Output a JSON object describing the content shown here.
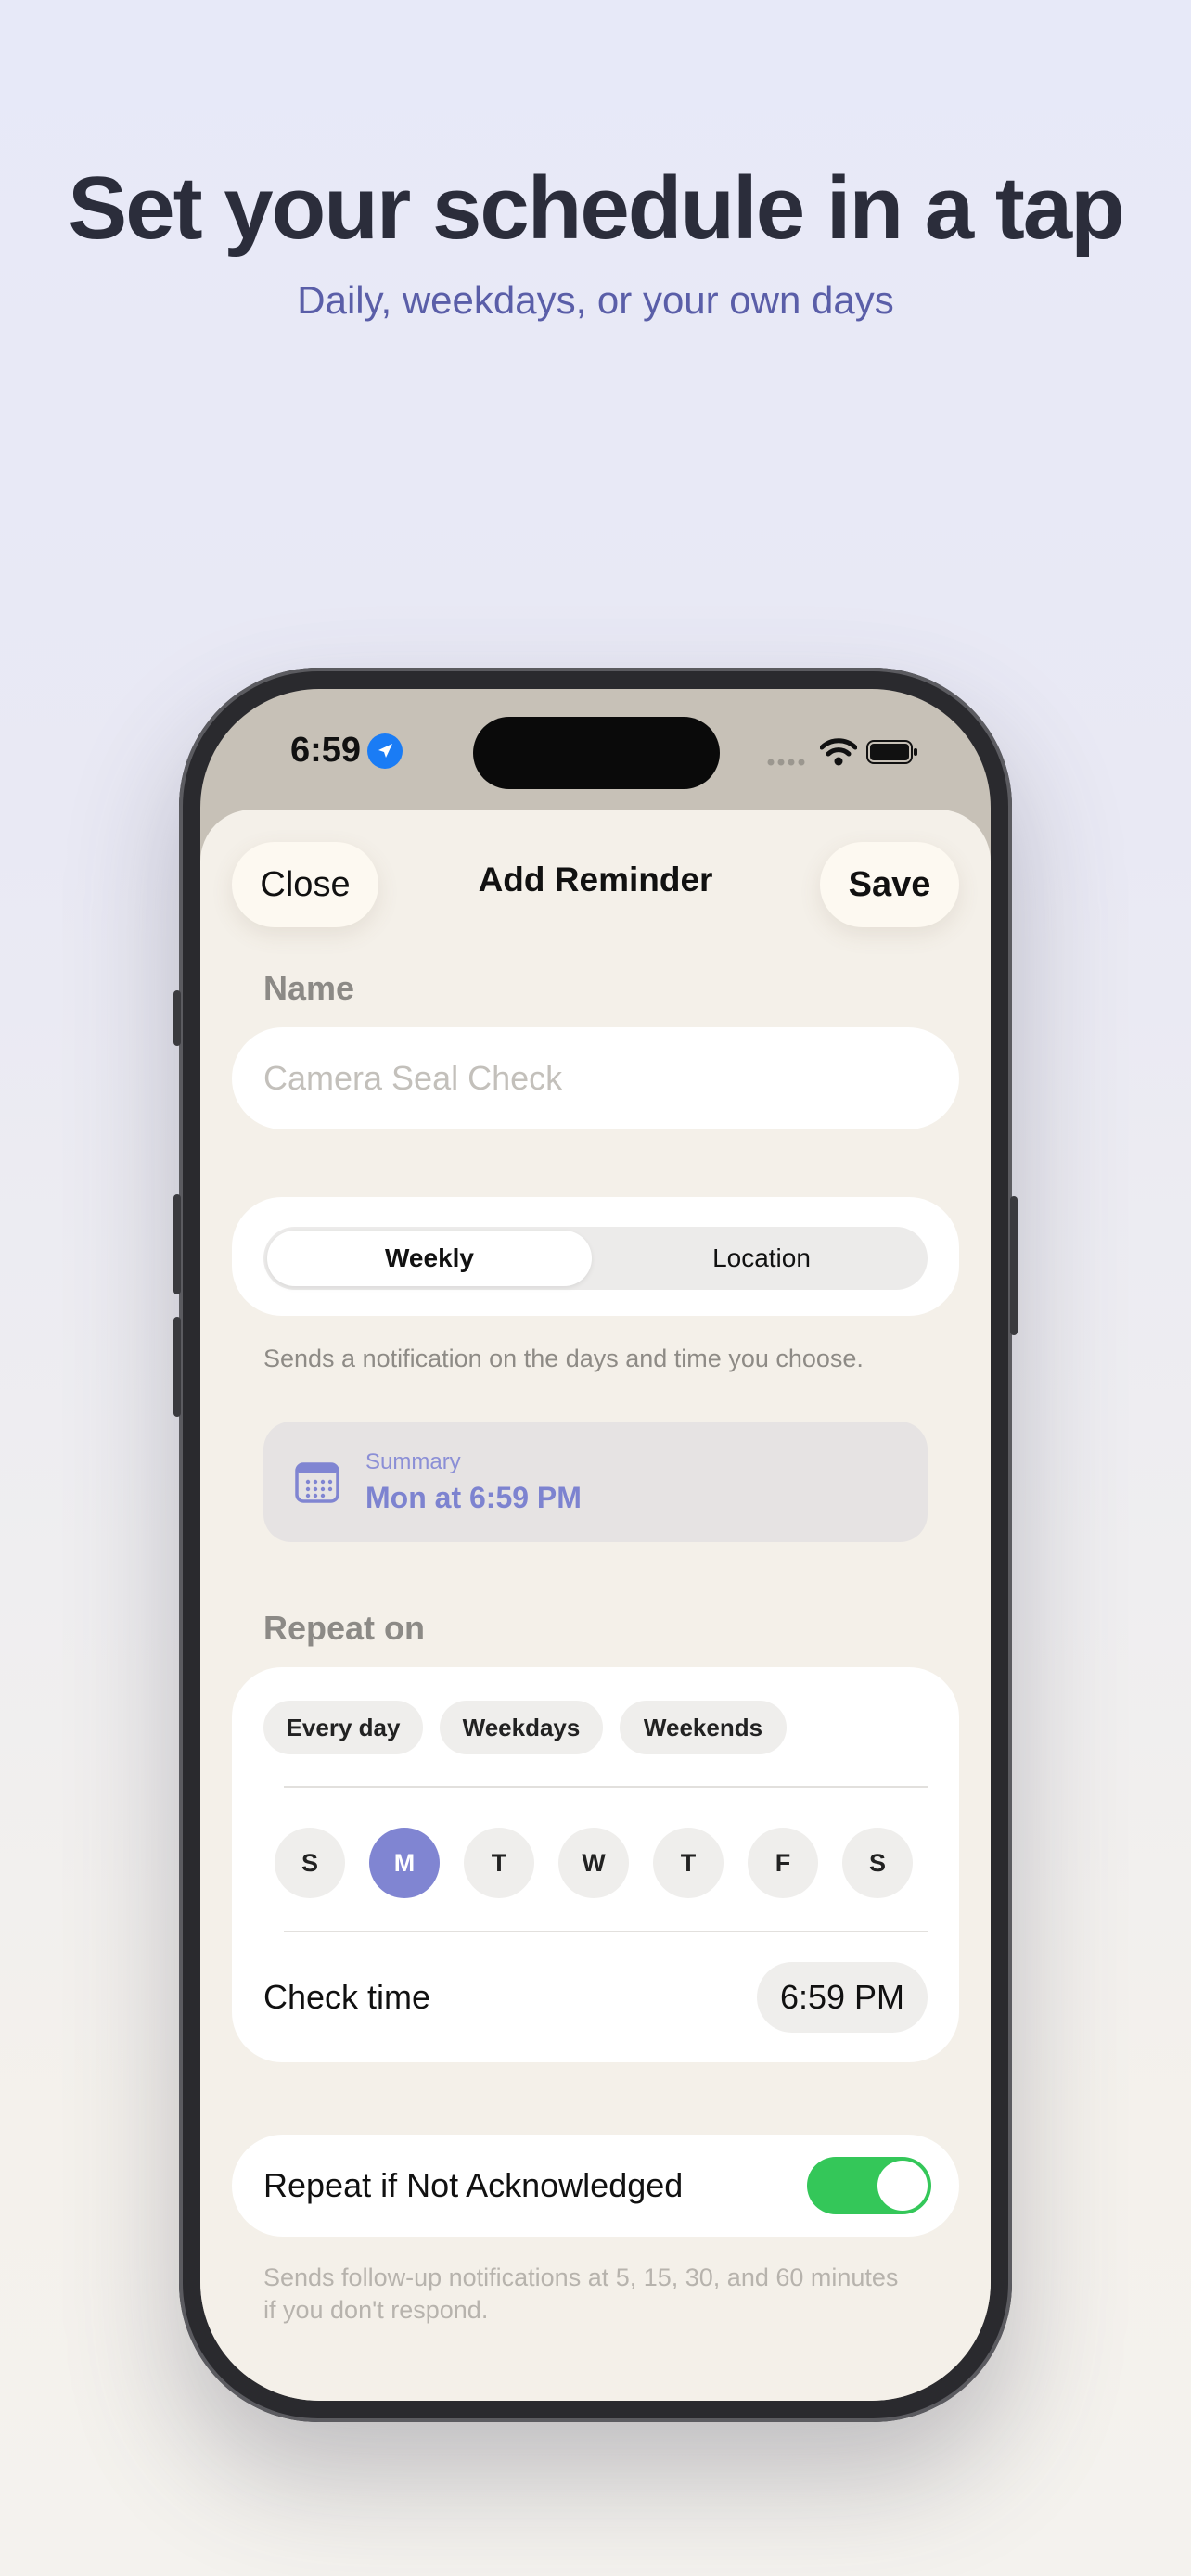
{
  "hero": {
    "title": "Set your schedule in a tap",
    "subtitle": "Daily, weekdays, or your own days"
  },
  "status_bar": {
    "time": "6:59",
    "icons": [
      "location-arrow-icon",
      "signal-icon",
      "wifi-icon",
      "battery-icon"
    ]
  },
  "nav": {
    "close_label": "Close",
    "title": "Add Reminder",
    "save_label": "Save"
  },
  "name_section": {
    "label": "Name",
    "placeholder": "Camera Seal Check",
    "value": ""
  },
  "schedule_type": {
    "options": [
      "Weekly",
      "Location"
    ],
    "selected": "Weekly",
    "helper": "Sends a notification on the days and time you choose."
  },
  "summary": {
    "label": "Summary",
    "value": "Mon at 6:59 PM"
  },
  "repeat": {
    "label": "Repeat on",
    "presets": [
      "Every day",
      "Weekdays",
      "Weekends"
    ],
    "days": [
      "S",
      "M",
      "T",
      "W",
      "T",
      "F",
      "S"
    ],
    "selected_day_index": 1,
    "check_time_label": "Check time",
    "check_time_value": "6:59 PM"
  },
  "acknowledge": {
    "label": "Repeat if Not Acknowledged",
    "enabled": true,
    "helper": "Sends follow-up notifications at 5, 15, 30, and 60 minutes if you don't respond."
  },
  "colors": {
    "accent": "#8085d2",
    "toggle_on": "#34c759",
    "headline": "#2b2d3b",
    "subhead": "#5a5ea8"
  }
}
